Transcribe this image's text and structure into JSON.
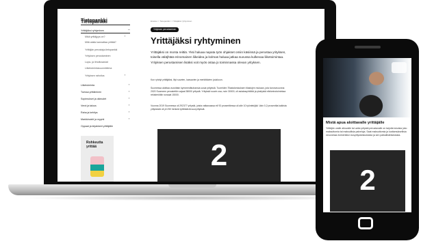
{
  "laptop": {
    "sidebar": {
      "title": "Tietopankki",
      "items": [
        {
          "label": "Yrittäjäksi ryhtyminen",
          "expanded": "−"
        },
        {
          "label": "Mikä yrittäjyys on?",
          "plus": "+"
        },
        {
          "label": "Mitä alalla kannattaa yrittää?"
        },
        {
          "label": "Yrittäjän perustaja-tietopankki"
        },
        {
          "label": "Yrityksen perustaminen"
        },
        {
          "label": "Lupa- ja ilmoitusasiat"
        },
        {
          "label": "Liiketoimintasuunnitelma"
        },
        {
          "label": "Yrityksen rahoitus",
          "plus": "+"
        },
        {
          "label": "Liiketoiminta",
          "plus": "+"
        },
        {
          "label": "Tuessa yrittäminen",
          "plus": "+"
        },
        {
          "label": "Sopimukset ja oikeudet",
          "plus": "+"
        },
        {
          "label": "Verot ja talous",
          "plus": "+"
        },
        {
          "label": "Raha ja kehitys",
          "plus": "+"
        },
        {
          "label": "Markkinointi ja myynti",
          "plus": "+"
        },
        {
          "label": "Oppaat ja kirjakkeet yrittäjälle"
        }
      ],
      "promo": "Rohkeutta yrittää"
    },
    "article": {
      "breadcrumb": "Etusivu  >  Tietopankki  >  Yrittäjäksi ryhtyminen",
      "tag": "Yrityksen perustaminen",
      "title": "Yrittäjäksi ryhtyminen",
      "lead": "Yrittäjäksi on monta reittiä. Yksi haluaa napata työn ohjakset omiin käsiinsä ja perustaa yrityksen, toisella väläjhtää erinomainen liikeidea ja kolmas haluaa jatkaa suvussa kulkevaa liiketoimintaa. Yrityksen perustamisen lisäksi voit myös ostaa jo toiminnassa olevan yrityksen.",
      "p1": "Kun ryhdyt yrittäjäksi, lilyt suurten, kasvavien ja merkittävien joukkoon.",
      "p2": "Suomessa aloittaa vuosittain kymmeniätuhansia uusia yrityksiä. Tuoreiden Tilastokeskuksen tilastojen mukaan, jota koronavuonna 2020 Suomeen perustettiin vajaat 38000 yritystä. Yrityksiä suurin osa, noin 30000, oli asiakasyhtiöitä ja yksityisiä elinkeinotoimintaa rekisteröitiin runsaat 15000.",
      "p3": "Vuonna 2019 Suomessa oli 292377 yritystä, joista valtaosassa eli 93 prosenttiessa oli alle 10 työntekijää. Vain 0,2 prosenttia kaikista yrityksistä oli yli 250 henkeä työllistäviä suuryrityksiä.",
      "video_number": "2"
    }
  },
  "phone": {
    "title": "Mistä apua aloittavalle yrittäjälle",
    "text": "Yrittäjän uralle aikovalle tai uutta yritystä perustavalle on tarjolla lukuisia joko maksuttomia tai maksullisia palveluja. Saat maksuttomia ja luottamuksellisia neuvontaa esimerkiksi Uusyrityskeskuksista ja sen paikallisteksistosta.",
    "video_number": "2"
  }
}
